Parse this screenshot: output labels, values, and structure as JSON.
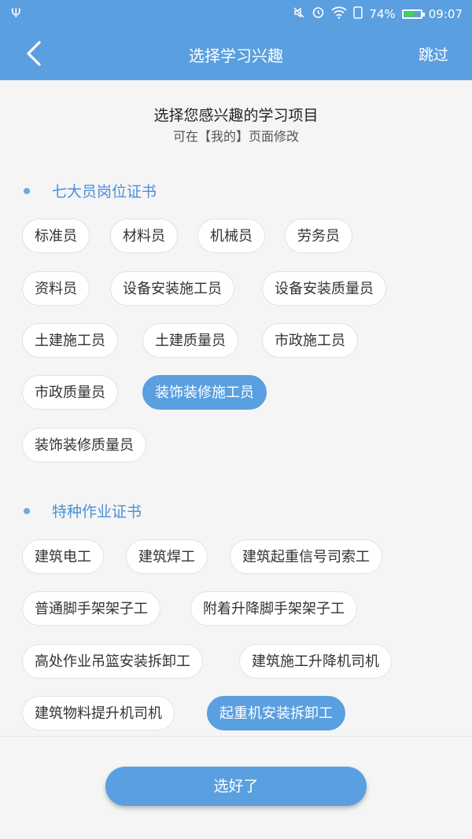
{
  "status_bar": {
    "usb_icon": "usb-icon",
    "battery_percent": "74%",
    "battery_level": 0.74,
    "time": "09:07",
    "colors": {
      "battery_fill": "#3fd35c"
    }
  },
  "nav": {
    "title": "选择学习兴趣",
    "skip_label": "跳过",
    "back_icon": "chevron-left-icon"
  },
  "intro": {
    "title": "选择您感兴趣的学习项目",
    "subtitle": "可在【我的】页面修改"
  },
  "sections": [
    {
      "title": "七大员岗位证书",
      "chips": [
        {
          "label": "标准员",
          "selected": false
        },
        {
          "label": "材料员",
          "selected": false
        },
        {
          "label": "机械员",
          "selected": false
        },
        {
          "label": "劳务员",
          "selected": false
        },
        {
          "label": "资料员",
          "selected": false
        },
        {
          "label": "设备安装施工员",
          "selected": false
        },
        {
          "label": "设备安装质量员",
          "selected": false
        },
        {
          "label": "土建施工员",
          "selected": false
        },
        {
          "label": "土建质量员",
          "selected": false
        },
        {
          "label": "市政施工员",
          "selected": false
        },
        {
          "label": "市政质量员",
          "selected": false
        },
        {
          "label": "装饰装修施工员",
          "selected": true
        },
        {
          "label": "装饰装修质量员",
          "selected": false
        }
      ]
    },
    {
      "title": "特种作业证书",
      "chips": [
        {
          "label": "建筑电工",
          "selected": false
        },
        {
          "label": "建筑焊工",
          "selected": false
        },
        {
          "label": "建筑起重信号司索工",
          "selected": false
        },
        {
          "label": "普通脚手架架子工",
          "selected": false
        },
        {
          "label": "附着升降脚手架架子工",
          "selected": false
        },
        {
          "label": "高处作业吊篮安装拆卸工",
          "selected": false
        },
        {
          "label": "建筑施工升降机司机",
          "selected": false
        },
        {
          "label": "建筑物料提升机司机",
          "selected": false
        },
        {
          "label": "起重机安装拆卸工",
          "selected": true
        }
      ]
    }
  ],
  "footer": {
    "confirm_label": "选好了"
  },
  "colors": {
    "accent": "#5a9fe0",
    "section_title": "#4a90d8"
  }
}
